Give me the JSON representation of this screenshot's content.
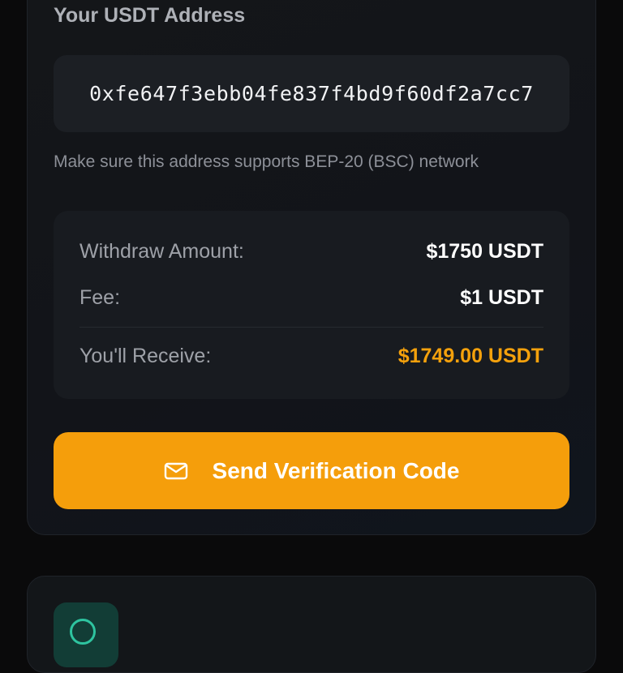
{
  "address_section": {
    "label": "Your USDT Address",
    "value": "0xfe647f3ebb04fe837f4bd9f60df2a7cc7",
    "hint": "Make sure this address supports BEP-20 (BSC) network"
  },
  "summary": {
    "rows": [
      {
        "label": "Withdraw Amount:",
        "value": "$1750 USDT"
      },
      {
        "label": "Fee:",
        "value": "$1 USDT"
      },
      {
        "label": "You'll Receive:",
        "value": "$1749.00 USDT"
      }
    ]
  },
  "send_button": {
    "label": "Send Verification Code",
    "icon": "mail-icon"
  },
  "colors": {
    "accent": "#f59e0b",
    "receive": "#f4a10c",
    "background": "#0a0a0b",
    "card": "#141619",
    "secondary_icon": "#2ec4a0"
  }
}
